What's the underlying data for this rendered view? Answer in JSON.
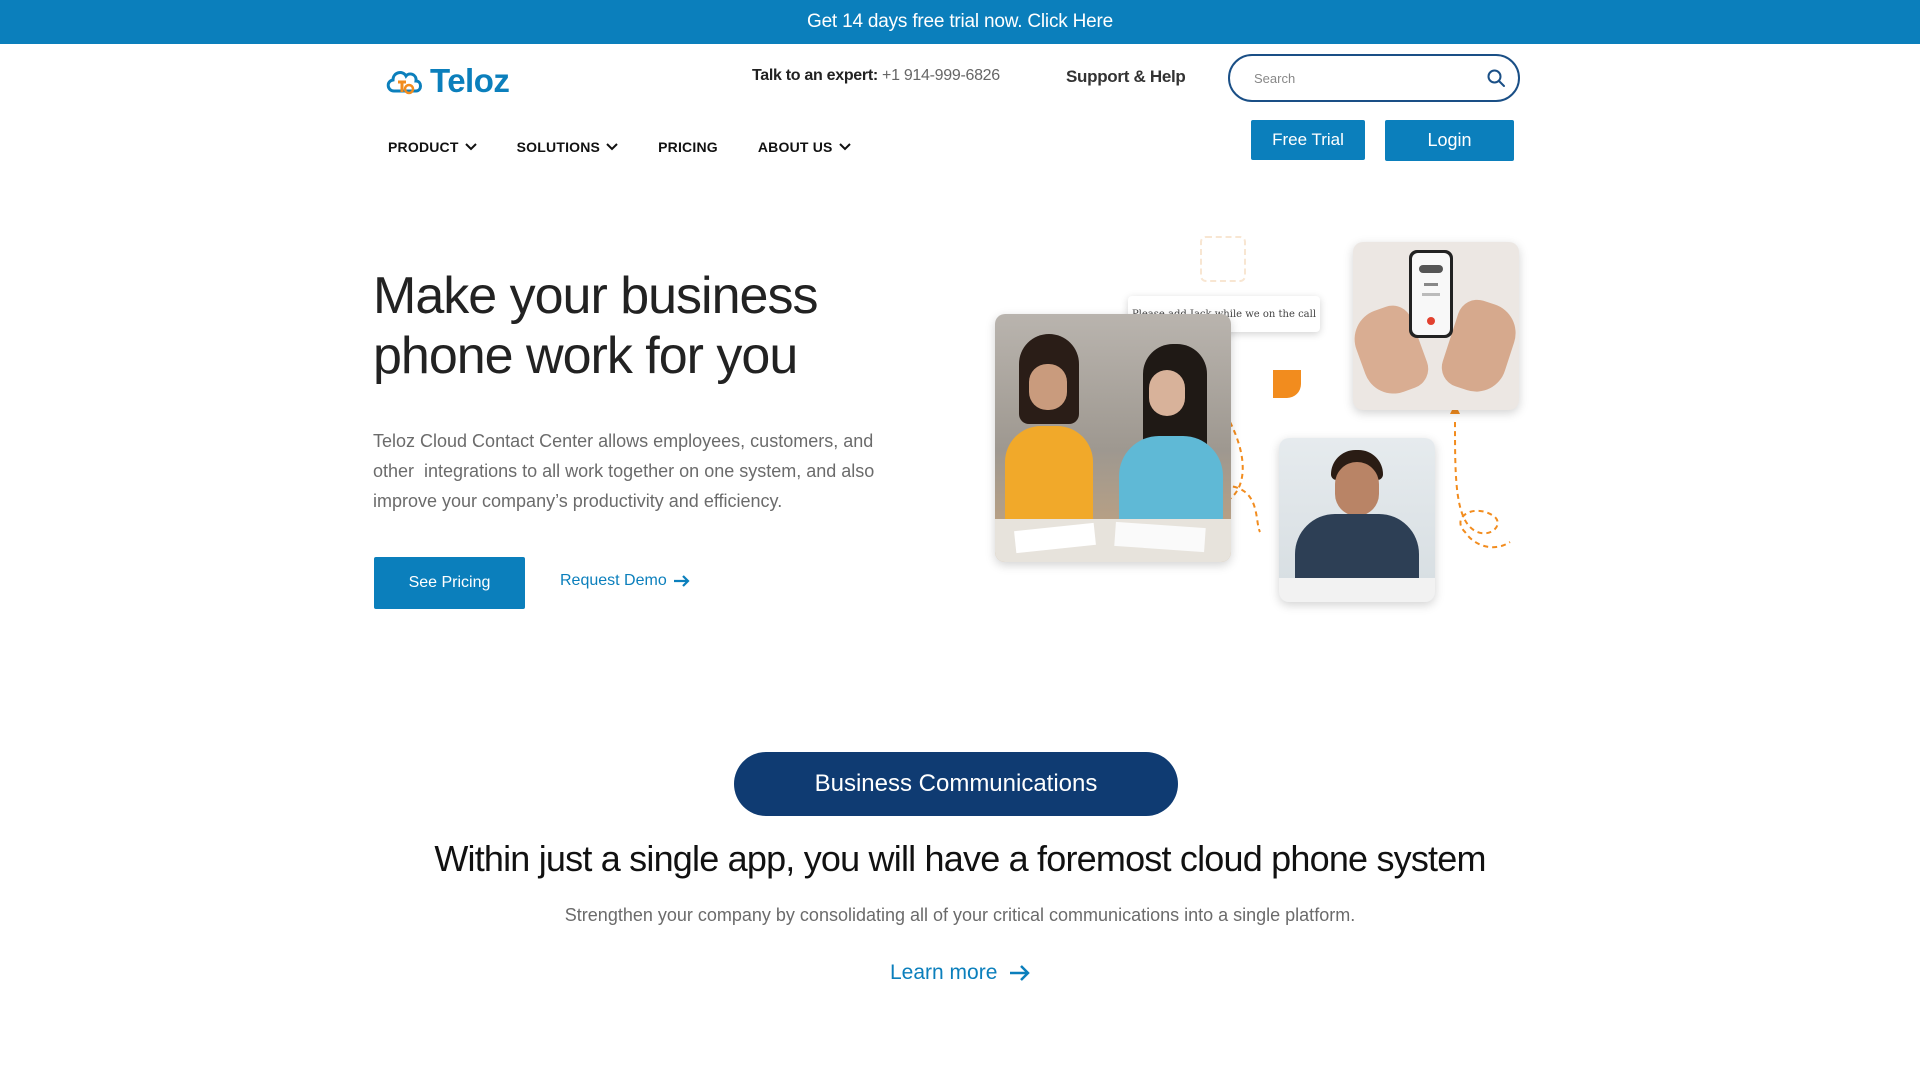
{
  "announcement": {
    "text": "Get 14 days free trial now. Click Here"
  },
  "brand": {
    "name": "Teloz",
    "color": "#0b7fbc",
    "accent": "#f28c1e"
  },
  "header": {
    "expert_label": "Talk to an expert:",
    "expert_phone": "+1 914-999-6826",
    "support": "Support & Help",
    "search_placeholder": "Search",
    "free_trial": "Free Trial",
    "login": "Login"
  },
  "nav": [
    {
      "label": "PRODUCT",
      "dropdown": true
    },
    {
      "label": "SOLUTIONS",
      "dropdown": true
    },
    {
      "label": "PRICING",
      "dropdown": false
    },
    {
      "label": "ABOUT US",
      "dropdown": true
    }
  ],
  "hero": {
    "title_line1": "Make your business",
    "title_line2": "phone work for you",
    "desc_line1": "Teloz Cloud Contact Center allows employees, customers, and",
    "desc_line2": "other  integrations to all work together on one system, and also",
    "desc_line3": "improve your company’s productivity and efficiency.",
    "cta_primary": "See Pricing",
    "cta_secondary": "Request Demo",
    "tooltip": "Please add Jack while we on the call"
  },
  "section": {
    "badge": "Business Communications",
    "title": "Within just a single app, you will have a foremost cloud phone system",
    "subtitle": "Strengthen your company by consolidating all of your critical communications into a single platform.",
    "link": "Learn more"
  },
  "colors": {
    "primary": "#0b7fbc",
    "navy": "#0f3b72",
    "text_muted": "#6b6b6b"
  }
}
